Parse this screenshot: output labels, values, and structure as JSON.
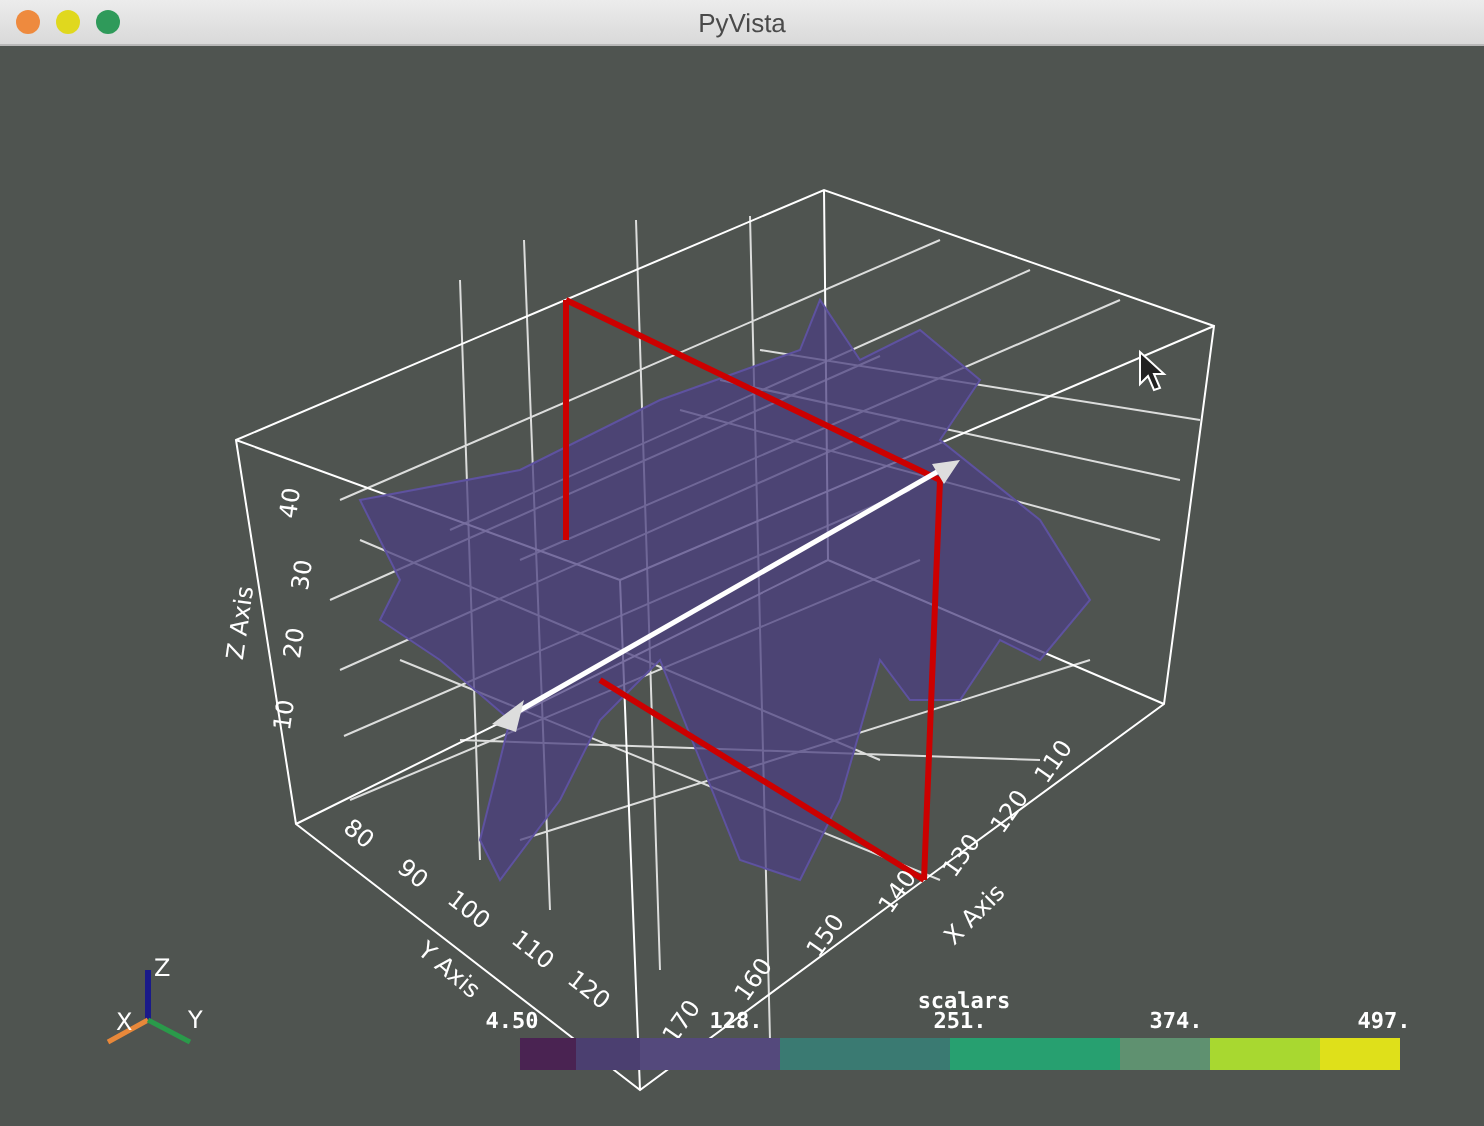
{
  "window": {
    "title": "PyVista"
  },
  "axes": {
    "x": {
      "title": "X Axis",
      "ticks": [
        "110",
        "120",
        "130",
        "140",
        "150",
        "160",
        "170"
      ]
    },
    "y": {
      "title": "Y Axis",
      "ticks": [
        "80",
        "90",
        "100",
        "110",
        "120"
      ]
    },
    "z": {
      "title": "Z Axis",
      "ticks": [
        "10",
        "20",
        "30",
        "40"
      ]
    }
  },
  "orientation_widget": {
    "x": "X",
    "y": "Y",
    "z": "Z"
  },
  "scalar_bar": {
    "title": "scalars",
    "labels": [
      "4.50",
      "128.",
      "251.",
      "374.",
      "497."
    ],
    "segments": [
      {
        "color": "#4a2352"
      },
      {
        "color": "#4b3f70"
      },
      {
        "color": "#54497c"
      },
      {
        "color": "#3a7a72"
      },
      {
        "color": "#27a070"
      },
      {
        "color": "#5f9170"
      },
      {
        "color": "#a8d830"
      },
      {
        "color": "#dfe01a"
      }
    ]
  }
}
